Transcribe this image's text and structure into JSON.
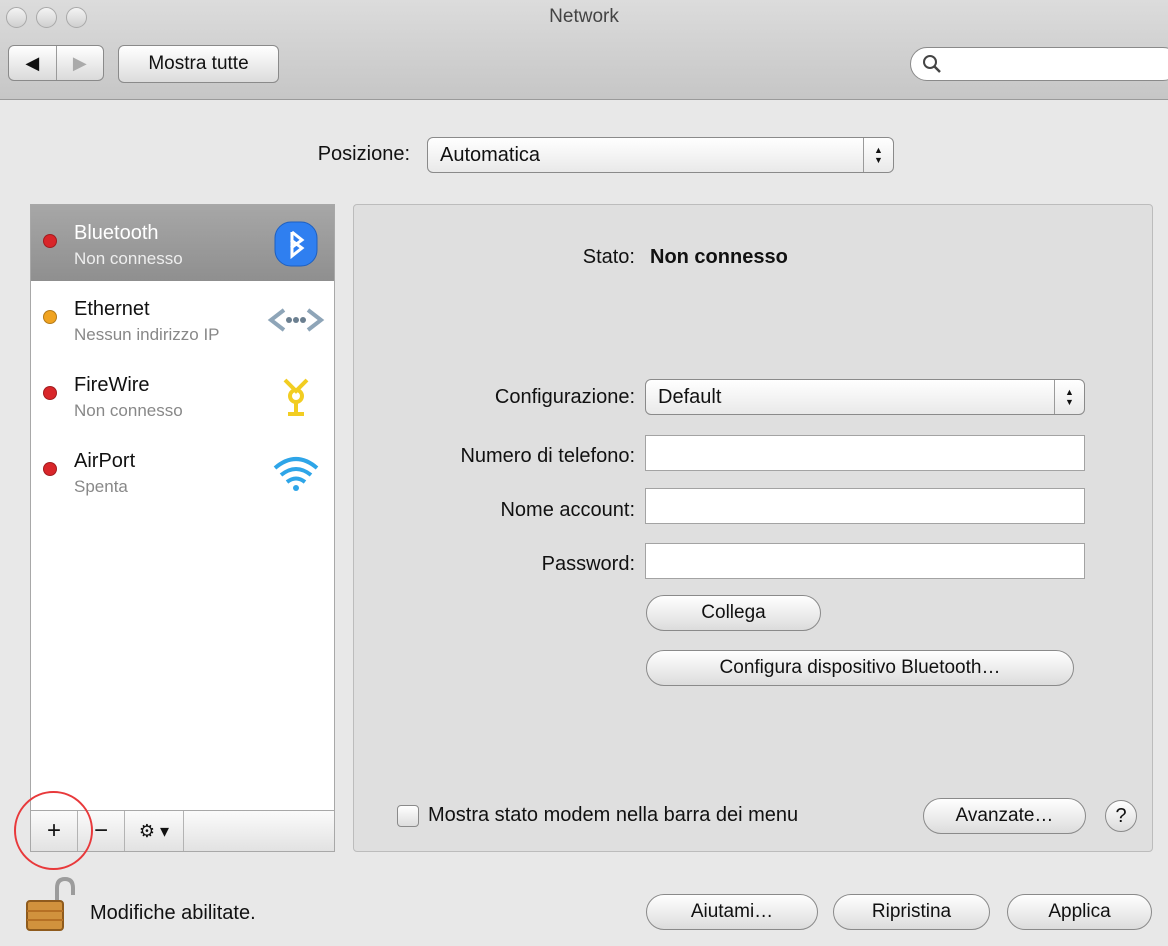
{
  "window": {
    "title": "Network"
  },
  "toolbar": {
    "show_all_label": "Mostra tutte",
    "search_placeholder": ""
  },
  "location": {
    "label": "Posizione:",
    "value": "Automatica"
  },
  "services": [
    {
      "name": "Bluetooth",
      "status": "Non connesso",
      "dot_color": "#d9262a",
      "icon": "bluetooth-icon",
      "selected": true
    },
    {
      "name": "Ethernet",
      "status": "Nessun indirizzo IP",
      "dot_color": "#f0a320",
      "icon": "ethernet-icon",
      "selected": false
    },
    {
      "name": "FireWire",
      "status": "Non connesso",
      "dot_color": "#d9262a",
      "icon": "firewire-icon",
      "selected": false
    },
    {
      "name": "AirPort",
      "status": "Spenta",
      "dot_color": "#d9262a",
      "icon": "airport-wifi-icon",
      "selected": false
    }
  ],
  "sidebar_actions": {
    "add": "+",
    "remove": "−",
    "gear": "⚙ ▾"
  },
  "detail": {
    "status_label": "Stato:",
    "status_value": "Non connesso",
    "configuration_label": "Configurazione:",
    "configuration_value": "Default",
    "phone_label": "Numero di telefono:",
    "phone_value": "",
    "account_label": "Nome account:",
    "account_value": "",
    "password_label": "Password:",
    "password_value": "",
    "connect_button": "Collega",
    "configure_button": "Configura dispositivo Bluetooth…",
    "show_modem_status": "Mostra stato modem nella barra dei menu",
    "advanced_button": "Avanzate…",
    "help": "?"
  },
  "footer": {
    "lock_text": "Modifiche abilitate.",
    "assist_button": "Aiutami…",
    "revert_button": "Ripristina",
    "apply_button": "Applica"
  }
}
